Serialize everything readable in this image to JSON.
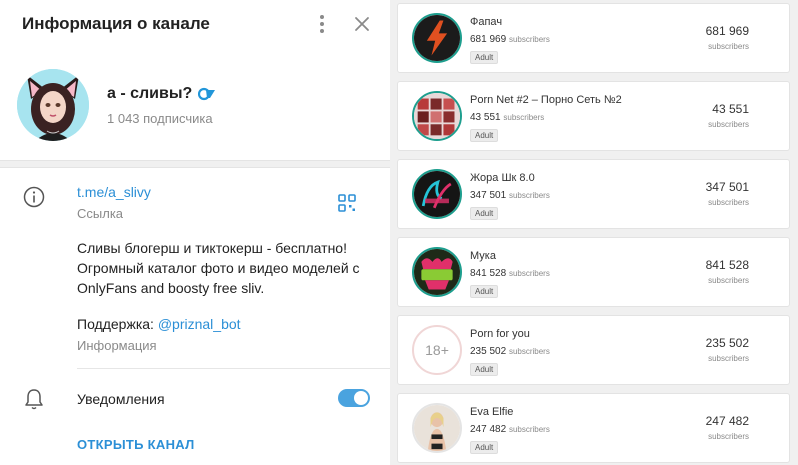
{
  "header": {
    "title": "Информация о канале"
  },
  "channel": {
    "name": "а - сливы?",
    "subscribers": "1 043 подписчика",
    "link": "t.me/a_slivy",
    "link_caption": "Ссылка",
    "description": [
      "Сливы блогерш и тиктокерш - бесплатно!",
      "Огромный каталог фото и видео моделей с",
      "OnlyFans and boosty free sliv."
    ],
    "support_prefix": "Поддержка: ",
    "support_handle": "@priznal_bot",
    "support_caption": "Информация",
    "notifications_label": "Уведомления",
    "notifications_on": true,
    "open_button": "ОТКРЫТЬ КАНАЛ"
  },
  "colors": {
    "accent": "#2b8fd6",
    "toggle": "#4aa3df",
    "ring": "#1d9e8e"
  },
  "list": [
    {
      "name": "Фапач",
      "count": "681 969",
      "count_word": "subscribers",
      "badge": "Adult",
      "right_value": "681 969",
      "right_label": "subscribers",
      "avatar": "lightning-logo"
    },
    {
      "name": "Porn Net #2 – Порно Сеть №2",
      "count": "43 551",
      "count_word": "subscribers",
      "badge": "Adult",
      "right_value": "43 551",
      "right_label": "subscribers",
      "avatar": "collage-logo"
    },
    {
      "name": "Жора Шк 8.0",
      "count": "347 501",
      "count_word": "subscribers",
      "badge": "Adult",
      "right_value": "347 501",
      "right_label": "subscribers",
      "avatar": "neon-logo"
    },
    {
      "name": "Мука",
      "count": "841 528",
      "count_word": "subscribers",
      "badge": "Adult",
      "right_value": "841 528",
      "right_label": "subscribers",
      "avatar": "muka-logo"
    },
    {
      "name": "Porn for you",
      "count": "235 502",
      "count_word": "subscribers",
      "badge": "Adult",
      "right_value": "235 502",
      "right_label": "subscribers",
      "avatar": "18plus-logo",
      "avatar_text": "18+"
    },
    {
      "name": "Eva Elfie",
      "count": "247 482",
      "count_word": "subscribers",
      "badge": "Adult",
      "right_value": "247 482",
      "right_label": "subscribers",
      "avatar": "photo-avatar"
    }
  ]
}
